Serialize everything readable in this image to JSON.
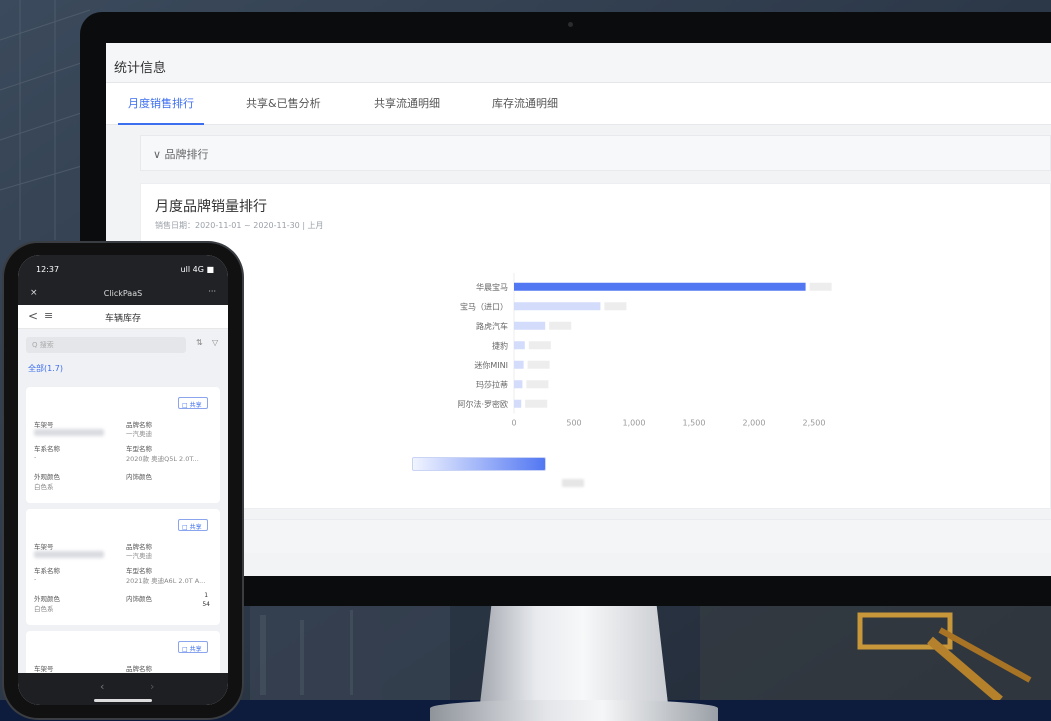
{
  "desktop": {
    "page_title": "统计信息",
    "tabs": [
      {
        "label": "月度销售排行",
        "active": true
      },
      {
        "label": "共享&已售分析",
        "active": false
      },
      {
        "label": "共享流通明细",
        "active": false
      },
      {
        "label": "库存流通明细",
        "active": false
      }
    ],
    "filter_section": "∨ 品牌排行",
    "card": {
      "title": "月度品牌销量排行",
      "subtitle": "销售日期：2020-11-01 ~ 2020-11-30  |  上月"
    }
  },
  "chart_data": {
    "type": "bar",
    "orientation": "horizontal",
    "categories": [
      "华晨宝马",
      "宝马（进口）",
      "路虎汽车",
      "捷豹",
      "迷你MINI",
      "玛莎拉蒂",
      "阿尔法·罗密欧"
    ],
    "values": [
      2430,
      720,
      260,
      90,
      80,
      70,
      60
    ],
    "xlim": [
      0,
      2500
    ],
    "xticks": [
      "0",
      "500",
      "1,000",
      "1,500",
      "2,000",
      "2,500"
    ],
    "colors": {
      "primary": "#5277f2",
      "secondary": "#d3dcfb"
    }
  },
  "phone": {
    "time": "12:37",
    "signal": "ull 4G ■",
    "app_name": "ClickPaaS",
    "close_icon": "×",
    "more_icon": "···",
    "back_icon": "<",
    "menu_icon": "≡",
    "page_title": "车辆库存",
    "search_placeholder": "Q 搜索",
    "sort_icon": "⇅",
    "filter_icon": "▽",
    "all_tab": "全部(1.7)",
    "cards": [
      {
        "badge": "□ 共享",
        "f1_label": "车架号",
        "f2_label": "品牌名称",
        "f2_value": "一汽奥迪",
        "f3_label": "车系名称",
        "f3_value": "-",
        "f4_label": "车型名称",
        "f4_value": "2020款 奥迪Q5L 2.0T...",
        "f5_label": "外观颜色",
        "f5_value": "白色系",
        "f6_label": "内饰颜色"
      },
      {
        "badge": "□ 共享",
        "f1_label": "车架号",
        "f2_label": "品牌名称",
        "f2_value": "一汽奥迪",
        "f3_label": "车系名称",
        "f3_value": "-",
        "f4_label": "车型名称",
        "f4_value": "2021款 奥迪A6L 2.0T A...",
        "f5_label": "外观颜色",
        "f5_value": "白色系",
        "f6_label": "内饰颜色",
        "qty": "1",
        "qty_unit": "54"
      },
      {
        "badge": "□ 共享",
        "f1_label": "车架号",
        "f2_label": "品牌名称"
      }
    ],
    "nav_back": "‹",
    "nav_forward": "›"
  }
}
